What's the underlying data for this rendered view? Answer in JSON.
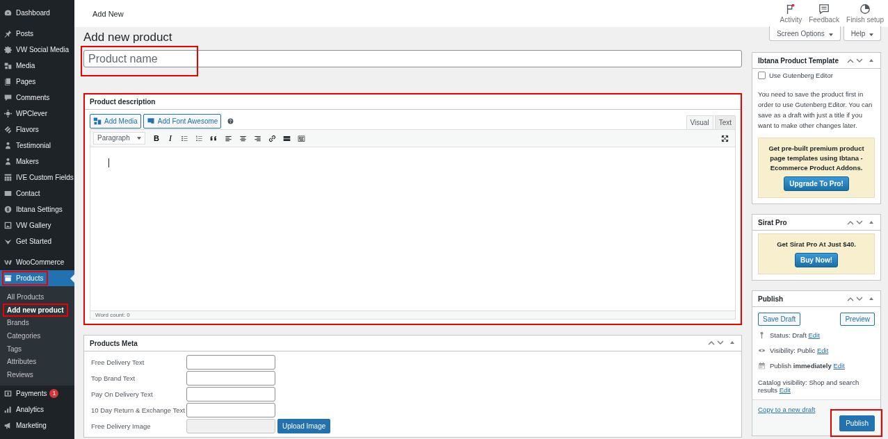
{
  "top_bar": {
    "title": "Add New",
    "actions": [
      {
        "label": "Activity",
        "notification": true
      },
      {
        "label": "Feedback",
        "notification": false
      },
      {
        "label": "Finish setup",
        "notification": false
      }
    ]
  },
  "sidebar": {
    "groups": [
      {
        "items": [
          {
            "label": "Dashboard",
            "selected": false,
            "highlighted": false
          }
        ]
      },
      {
        "items": [
          {
            "label": "Posts",
            "selected": false,
            "highlighted": false
          },
          {
            "label": "VW Social Media",
            "selected": false,
            "highlighted": false
          },
          {
            "label": "Media",
            "selected": false,
            "highlighted": false
          },
          {
            "label": "Pages",
            "selected": false,
            "highlighted": false
          },
          {
            "label": "Comments",
            "selected": false,
            "highlighted": false
          },
          {
            "label": "WPClever",
            "selected": false,
            "highlighted": false
          },
          {
            "label": "Flavors",
            "selected": false,
            "highlighted": false
          },
          {
            "label": "Testimonial",
            "selected": false,
            "highlighted": false
          },
          {
            "label": "Makers",
            "selected": false,
            "highlighted": false
          },
          {
            "label": "IVE Custom Fields",
            "selected": false,
            "highlighted": false
          },
          {
            "label": "Contact",
            "selected": false,
            "highlighted": false
          },
          {
            "label": "Ibtana Settings",
            "selected": false,
            "highlighted": false
          },
          {
            "label": "VW Gallery",
            "selected": false,
            "highlighted": false
          },
          {
            "label": "Get Started",
            "selected": false,
            "highlighted": false
          }
        ]
      },
      {
        "items": [
          {
            "label": "WooCommerce",
            "selected": false,
            "highlighted": false
          },
          {
            "label": "Products",
            "selected": true,
            "highlighted": true,
            "children": [
              {
                "label": "All Products",
                "selected": false,
                "highlighted": false
              },
              {
                "label": "Add new product",
                "selected": true,
                "highlighted": true
              },
              {
                "label": "Brands",
                "selected": false,
                "highlighted": false
              },
              {
                "label": "Categories",
                "selected": false,
                "highlighted": false
              },
              {
                "label": "Tags",
                "selected": false,
                "highlighted": false
              },
              {
                "label": "Attributes",
                "selected": false,
                "highlighted": false
              },
              {
                "label": "Reviews",
                "selected": false,
                "highlighted": false
              }
            ]
          },
          {
            "label": "Payments",
            "selected": false,
            "highlighted": false,
            "badge": "1"
          },
          {
            "label": "Analytics",
            "selected": false,
            "highlighted": false
          },
          {
            "label": "Marketing",
            "selected": false,
            "highlighted": false
          }
        ]
      }
    ]
  },
  "screen_options": "Screen Options",
  "help": "Help",
  "page_title": "Add new product",
  "title_field": {
    "placeholder": "Product name",
    "highlighted": true
  },
  "description": {
    "title": "Product description",
    "highlighted": true,
    "media_buttons": [
      "Add Media",
      "Add Font Awesome"
    ],
    "tabs": [
      {
        "label": "Visual",
        "selected": true
      },
      {
        "label": "Text",
        "selected": false
      }
    ],
    "format": "Paragraph",
    "bold_glyph": "B",
    "italic_glyph": "I",
    "word_count": "Word count: 0"
  },
  "products_meta": {
    "title": "Products Meta",
    "fields": [
      {
        "label": "Free Delivery Text",
        "kind": "text"
      },
      {
        "label": "Top Brand Text",
        "kind": "text"
      },
      {
        "label": "Pay On Delivery Text",
        "kind": "text"
      },
      {
        "label": "10 Day Return & Exchange Text",
        "kind": "text"
      },
      {
        "label": "Free Delivery Image",
        "kind": "image",
        "button": "Upload Image"
      }
    ]
  },
  "ibtana": {
    "title": "Ibtana Product Template",
    "checkbox": {
      "label": "Use Gutenberg Editor",
      "checked": false
    },
    "notice": "You need to save the product first in order to use Gutenberg Editor. You can save as a draft with just a title if you want to make other changes later.",
    "promo": {
      "text": "Get pre-built premium product page templates using Ibtana - Ecommerce Product Addons.",
      "button": "Upgrade To Pro!"
    }
  },
  "sirat": {
    "title": "Sirat Pro",
    "promo": {
      "text": "Get Sirat Pro At Just $40.",
      "button": "Buy Now!"
    }
  },
  "publish": {
    "title": "Publish",
    "save_draft": "Save Draft",
    "preview": "Preview",
    "rows": [
      {
        "kind": "status",
        "text": "Status: Draft",
        "link": "Edit"
      },
      {
        "kind": "visibility",
        "text": "Visibility: Public",
        "link": "Edit"
      },
      {
        "kind": "schedule",
        "text": "Publish **immediately**",
        "link": "Edit"
      },
      {
        "kind": "catalog",
        "text": "Catalog visibility: Shop and search results",
        "link": "Edit"
      }
    ],
    "copy_link": "Copy to a new draft",
    "publish_button": {
      "label": "Publish",
      "highlighted": true
    }
  }
}
